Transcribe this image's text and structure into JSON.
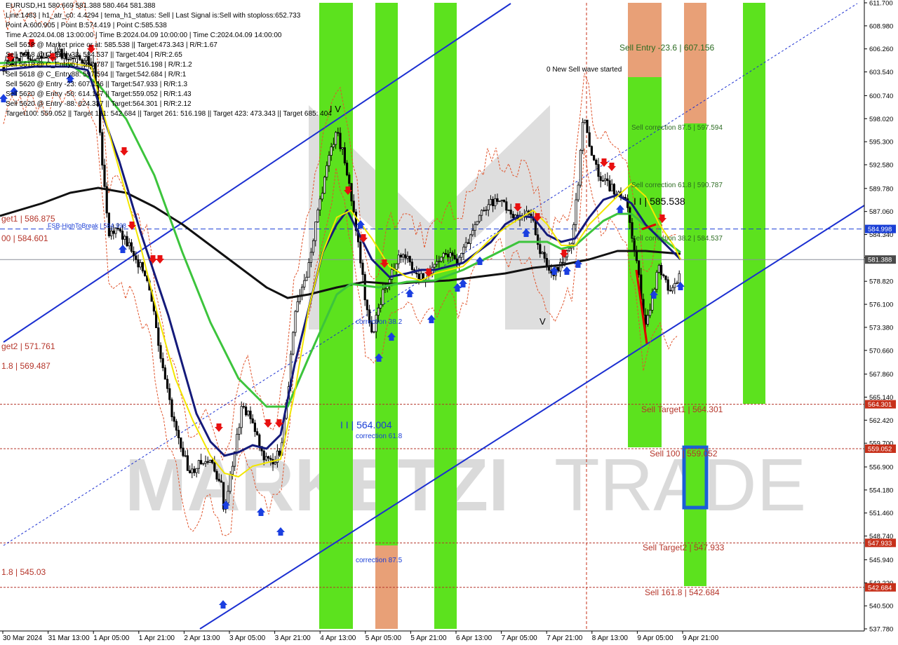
{
  "header": {
    "symbol": "EURUSD,H1",
    "ohlc": "580.669 581.388 580.464 581.388",
    "info_lines": [
      "EURUSD,H1  580.669 581.388 580.464 581.388",
      "Line:1483 | h1_atr_c0: 4.4294 | tema_h1_status: Sell | Last Signal is:Sell with stoploss:652.733",
      "Point A:600.905 | Point B:574.419 | Point C:585.538",
      "Time A:2024.04.08 13:00:00 | Time B:2024.04.09 10:00:00 | Time C:2024.04.09 14:00:00",
      "Sell 5618 @ Market price or at: 585.538 || Target:473.343 | R/R:1.67",
      "Sell 5618 @ C_Entry38: 584.537 || Target:404 | R/R:2.65",
      "Sell 5618 @ C_Entry61: 590.787 || Target:516.198 | R/R:1.2",
      "Sell 5618 @ C_Entry88: 597.594 || Target:542.684 | R/R:1",
      "Sell 5620 @ Entry -23: 607.156 || Target:547.933 | R/R:1.3",
      "Sell 5620 @ Entry -50: 614.147 || Target:559.052 | R/R:1.43",
      "Sell 5620 @ Entry -88: 624.337 || Target:564.301 | R/R:2.12",
      "Target100: 559.052 || Target 161: 542.684 || Target 261: 516.198 || Target 423: 473.343 || Target 685: 404"
    ]
  },
  "price_axis": {
    "ticks": [
      "611.700",
      "608.980",
      "606.260",
      "603.540",
      "600.740",
      "598.020",
      "595.300",
      "592.580",
      "589.780",
      "587.060",
      "584.340",
      "581.620",
      "578.820",
      "576.100",
      "573.380",
      "570.660",
      "567.860",
      "565.140",
      "562.420",
      "559.700",
      "556.900",
      "554.180",
      "551.460",
      "548.740",
      "545.940",
      "543.220",
      "540.500",
      "537.780"
    ],
    "tags": [
      {
        "value": 584.998,
        "label": "584.998",
        "color": "#1a3fd6"
      },
      {
        "value": 581.388,
        "label": "581.388",
        "color": "#4a4a4a"
      },
      {
        "value": 564.301,
        "label": "564.301",
        "color": "#c7301a"
      },
      {
        "value": 559.052,
        "label": "559.052",
        "color": "#c7301a"
      },
      {
        "value": 547.933,
        "label": "547.933",
        "color": "#c7301a"
      },
      {
        "value": 542.684,
        "label": "542.684",
        "color": "#c7301a"
      }
    ]
  },
  "time_axis": {
    "labels": [
      "30 Mar 2024",
      "31 Mar 13:00",
      "1 Apr 05:00",
      "1 Apr 21:00",
      "2 Apr 13:00",
      "3 Apr 05:00",
      "3 Apr 21:00",
      "4 Apr 13:00",
      "5 Apr 05:00",
      "5 Apr 21:00",
      "6 Apr 13:00",
      "7 Apr 05:00",
      "7 Apr 21:00",
      "8 Apr 13:00",
      "9 Apr 05:00",
      "9 Apr 21:00"
    ]
  },
  "chart_data": {
    "type": "candlestick",
    "symbol": "EURUSD",
    "timeframe": "H1",
    "ylim": [
      537.78,
      611.7
    ],
    "current_price": 581.388,
    "levels": [
      {
        "name": "Sell Entry -23.6",
        "value": 607.156
      },
      {
        "name": "Sell correction 87.5",
        "value": 597.594
      },
      {
        "name": "Sell correction 61.8",
        "value": 590.787
      },
      {
        "name": "Sell correction 38.2",
        "value": 584.537
      },
      {
        "name": "Sell Target1",
        "value": 564.301
      },
      {
        "name": "Sell 100",
        "value": 559.052
      },
      {
        "name": "Sell Target2",
        "value": 547.933
      },
      {
        "name": "Sell 161.8",
        "value": 542.684
      }
    ],
    "points": {
      "A": 600.905,
      "B": 574.419,
      "C": 585.538
    }
  },
  "chart_labels": {
    "sell_entry": "Sell Entry -23.6 | 607.156",
    "new_wave": "0 New Sell wave started",
    "sell_corr_875": "Sell correction 87.5 | 597.594",
    "sell_corr_618": "Sell correction 61.8 | 590.787",
    "point_c": "I I | 585.538",
    "sell_corr_382": "Sell correction 38.2 | 584.537",
    "sell_target1": "Sell Target1 | 564.301",
    "sell_100": "Sell 100 | 559.052",
    "sell_target2": "Sell Target2 | 547.933",
    "sell_1618": "Sell 161.8 | 542.684",
    "wave_iv": "I V",
    "wave_v": "V",
    "wave_ii": "I I | 564.004",
    "corr_382": "correction 38.2",
    "corr_618": "correction 61.8",
    "corr_875": "correction 87.5",
    "fsb": "FSB-HighToBreak | 584.998",
    "target1_left": "get1 | 586.875",
    "lvl_584": "00 | 584.601",
    "target2_left": "get2 | 571.761",
    "lvl_569": "1.8 | 569.487",
    "lvl_545": "1.8 | 545.03"
  },
  "watermark": {
    "brand": "MARKETZI",
    "suffix": "TRADE"
  },
  "colors": {
    "candle": "#000000",
    "green_zone": "#5ce21e",
    "orange_zone": "#e8a077",
    "channel": "#1b2fd1",
    "target_line": "#b5352a",
    "fsb_line": "#1b3fd6",
    "ma_black": "#111111",
    "ma_green": "#3cc43c",
    "ma_navy": "#141a7a",
    "ma_yellow": "#f2e600",
    "envelope": "#e0542c"
  }
}
